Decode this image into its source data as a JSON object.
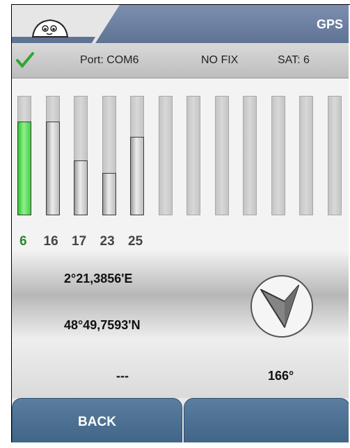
{
  "header": {
    "title": "GPS",
    "logo_icon": "michelin-logo"
  },
  "status": {
    "ok_icon": "check-icon",
    "port": "Port: COM6",
    "fix": "NO FIX",
    "sat": "SAT: 6"
  },
  "satellites": {
    "bars": [
      {
        "id": "6",
        "level": 0.78,
        "active": true
      },
      {
        "id": "16",
        "level": 0.78,
        "active": false
      },
      {
        "id": "17",
        "level": 0.45,
        "active": false
      },
      {
        "id": "23",
        "level": 0.35,
        "active": false
      },
      {
        "id": "25",
        "level": 0.65,
        "active": false
      },
      {
        "id": "",
        "level": 0,
        "active": false
      },
      {
        "id": "",
        "level": 0,
        "active": false
      },
      {
        "id": "",
        "level": 0,
        "active": false
      },
      {
        "id": "",
        "level": 0,
        "active": false
      },
      {
        "id": "",
        "level": 0,
        "active": false
      },
      {
        "id": "",
        "level": 0,
        "active": false
      },
      {
        "id": "",
        "level": 0,
        "active": false
      }
    ]
  },
  "position": {
    "longitude": "2°21,3856'E",
    "latitude": "48°49,7593'N",
    "speed": "---",
    "heading": "166°",
    "compass_icon": "compass-arrow-icon"
  },
  "buttons": {
    "back": "BACK",
    "right": ""
  },
  "colors": {
    "header": "#6a7fa2",
    "button": "#4b6f93",
    "active_bar": "#44cc44"
  }
}
